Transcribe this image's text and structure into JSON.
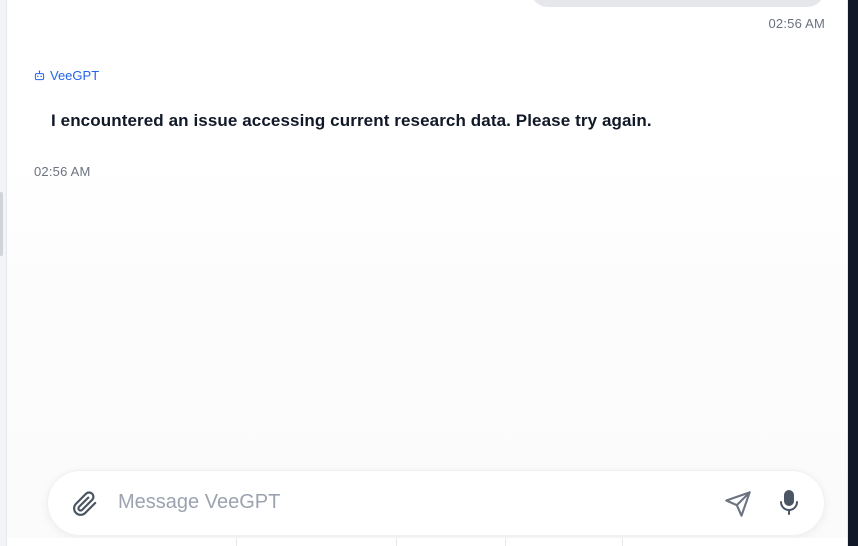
{
  "conversation": {
    "user_message_time": "02:56 AM",
    "bot": {
      "name": "VeeGPT",
      "icon": "bot-icon",
      "message": "I encountered an issue accessing current research data. Please try again.",
      "time": "02:56 AM"
    }
  },
  "composer": {
    "placeholder": "Message VeeGPT",
    "value": "",
    "icons": [
      "paperclip-icon",
      "send-icon",
      "microphone-icon"
    ]
  },
  "colors": {
    "accent": "#2563eb",
    "text": "#111827",
    "muted": "#6b7280",
    "placeholder": "#9ca3af",
    "user_bubble": "#e5e7eb"
  }
}
